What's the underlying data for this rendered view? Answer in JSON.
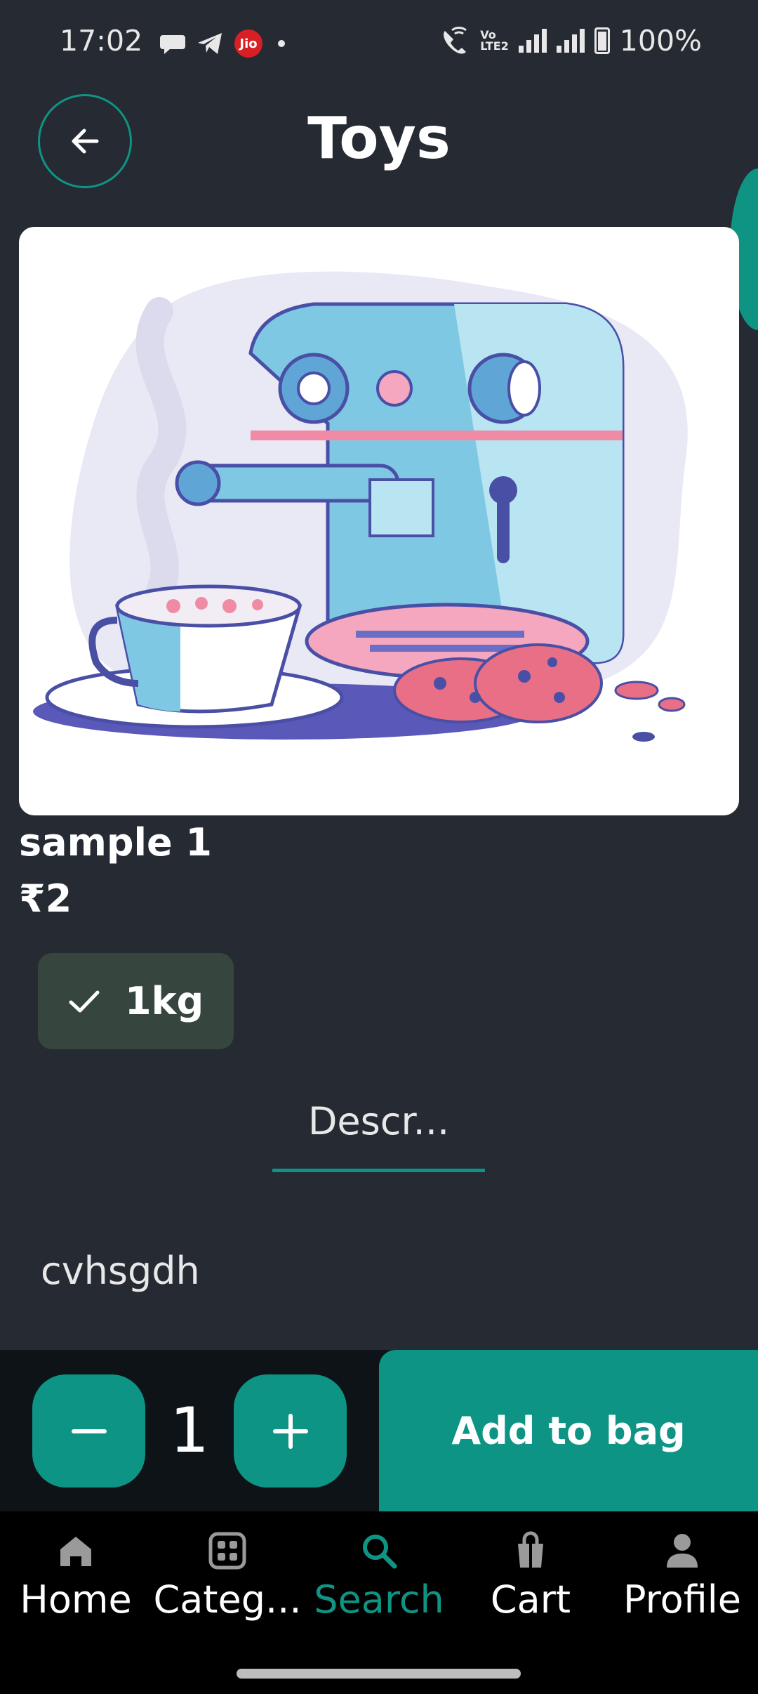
{
  "status_bar": {
    "time": "17:02",
    "carrier_badge": "Jio",
    "battery": "100%",
    "volte": "Vo LTE2"
  },
  "header": {
    "title": "Toys"
  },
  "product": {
    "name": "sample 1",
    "price": "₹2",
    "variant": "1kg",
    "tab_label": "Descr...",
    "description": "cvhsgdh"
  },
  "actions": {
    "quantity": "1",
    "add_to_bag": "Add to bag"
  },
  "nav": {
    "items": [
      {
        "label": "Home",
        "icon": "home-icon"
      },
      {
        "label": "Categ...",
        "icon": "grid-icon"
      },
      {
        "label": "Search",
        "icon": "search-icon"
      },
      {
        "label": "Cart",
        "icon": "bag-icon"
      },
      {
        "label": "Profile",
        "icon": "person-icon"
      }
    ],
    "active": "Search"
  },
  "colors": {
    "background": "#252a33",
    "accent": "#0f9484",
    "chip": "#36463f",
    "nav_bg": "#000000"
  }
}
